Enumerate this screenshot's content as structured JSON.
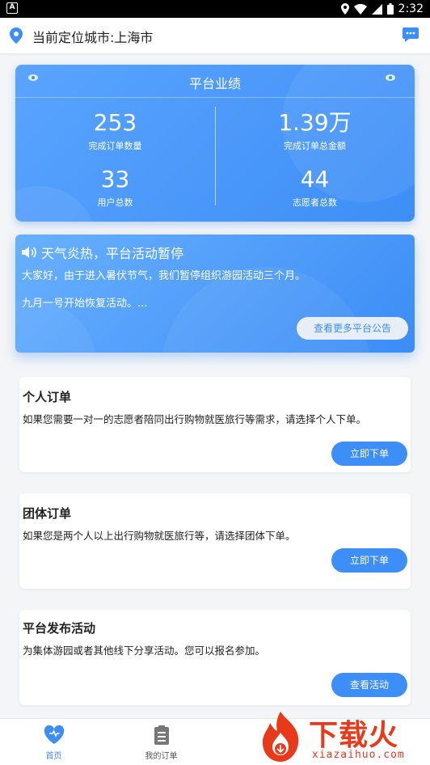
{
  "status_bar": {
    "time": "2:32",
    "left_badge": "A"
  },
  "header": {
    "title": "当前定位城市:上海市"
  },
  "stats": {
    "title": "平台业绩",
    "items": [
      {
        "value": "253",
        "label": "完成订单数量"
      },
      {
        "value": "1.39万",
        "label": "完成订单总金额"
      },
      {
        "value": "33",
        "label": "用户总数"
      },
      {
        "value": "44",
        "label": "志愿者总数"
      }
    ]
  },
  "notice": {
    "title": "天气炎热，平台活动暂停",
    "line1": "大家好，由于进入暑伏节气，我们暂停组织游园活动三个月。",
    "line2": "九月一号开始恢复活动。...",
    "button": "查看更多平台公告"
  },
  "cards": [
    {
      "title": "个人订单",
      "desc": "如果您需要一对一的志愿者陪同出行购物就医旅行等需求，请选择个人下单。",
      "button": "立即下单"
    },
    {
      "title": "团体订单",
      "desc": "如果您是两个人以上出行购物就医旅行等，请选择团体下单。",
      "button": "立即下单"
    },
    {
      "title": "平台发布活动",
      "desc": "为集体游园或者其他线下分享活动。您可以报名参加。",
      "button": "查看活动"
    }
  ],
  "tabbar": {
    "active_color": "#3d8ef6",
    "items": [
      {
        "label": "首页",
        "icon": "heart-icon"
      },
      {
        "label": "我的订单",
        "icon": "clipboard-icon"
      }
    ]
  },
  "watermark": {
    "text": "下载火",
    "sub": "xiazaihuo.com"
  },
  "colors": {
    "primary": "#3d8ef6",
    "watermark": "#e8391b"
  }
}
